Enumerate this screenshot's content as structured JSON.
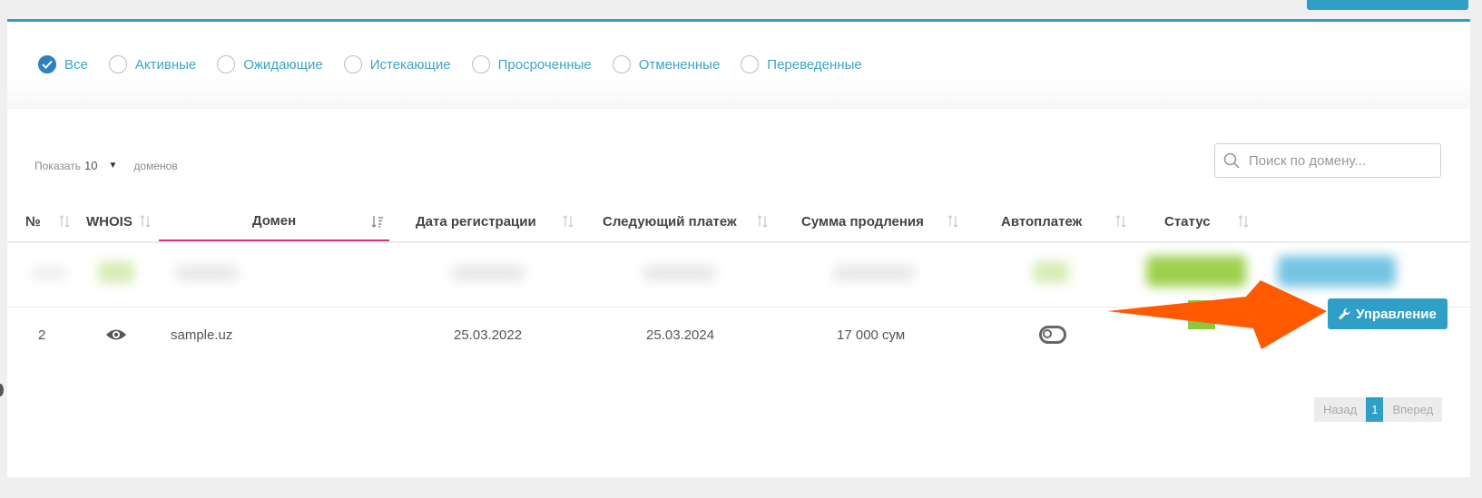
{
  "filters": [
    {
      "label": "Все",
      "checked": true
    },
    {
      "label": "Активные",
      "checked": false
    },
    {
      "label": "Ожидающие",
      "checked": false
    },
    {
      "label": "Истекающие",
      "checked": false
    },
    {
      "label": "Просроченные",
      "checked": false
    },
    {
      "label": "Отмененные",
      "checked": false
    },
    {
      "label": "Переведенные",
      "checked": false
    }
  ],
  "length_control": {
    "prefix": "Показать",
    "value": "10",
    "suffix": "доменов"
  },
  "search": {
    "placeholder": "Поиск по домену..."
  },
  "columns": [
    "№",
    "WHOIS",
    "Домен",
    "Дата регистрации",
    "Следующий платеж",
    "Сумма продления",
    "Автоплатеж",
    "Статус"
  ],
  "sorted_column": "Домен",
  "rows": [
    {
      "number": "2",
      "whois_icon": "eye-icon",
      "domain": "sample.uz",
      "registration_date": "25.03.2022",
      "next_payment": "25.03.2024",
      "renewal_amount": "17 000 сум",
      "autopay_on": false,
      "status_color": "#8dc63f",
      "action_label": "Управление",
      "action_icon": "wrench-icon"
    }
  ],
  "pagination": {
    "prev": "Назад",
    "current": "1",
    "next": "Вперед"
  },
  "colors": {
    "accent": "#2f9fc7",
    "filter_text": "#3ea4c4",
    "checked_radio": "#2f7fc1",
    "sort_underline": "#c9367a",
    "annotation_arrow": "#ff5a00",
    "status_active": "#8dc63f"
  }
}
